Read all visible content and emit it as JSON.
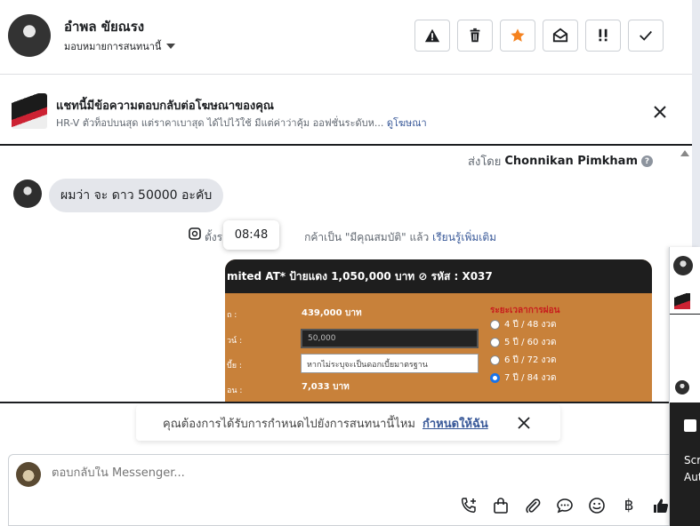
{
  "header": {
    "contact_name": "อำพล ขัยณรง",
    "assign_label": "มอบหมายการสนทนานี้",
    "actions": [
      {
        "name": "mark-spam",
        "icon": "warning-icon"
      },
      {
        "name": "delete",
        "icon": "trash-icon"
      },
      {
        "name": "star",
        "icon": "star-icon",
        "color": "#f5821f"
      },
      {
        "name": "mark-unread",
        "icon": "envelope-open-icon"
      },
      {
        "name": "priority",
        "icon": "exclamation-icon"
      },
      {
        "name": "mark-done",
        "icon": "check-icon"
      }
    ]
  },
  "ad_banner": {
    "title": "แชทนี้มีข้อความตอบกลับต่อโฆษณาของคุณ",
    "description": "HR-V ตัวท็อปบนสุด แต่ราคาเบาสุด ได้ไปไว้ใช้ มีแต่ค่าว่าคุ้ม ออฟชั่นระดับห...",
    "link_label": "ดูโฆษณา"
  },
  "conversation": {
    "sent_by_prefix": "ส่งโดย",
    "sent_by_name": "Chonnikan Pimkham",
    "message_text": "ผมว่า จะ ดาว  50000  อะคับ",
    "system_text_before": "ตั้งร",
    "system_text_after": "กค้าเป็น \"มีคุณสมบัติ\" แล้ว",
    "system_link": "เรียนรู้เพิ่มเติม",
    "timestamp": "08:48"
  },
  "car_image": {
    "header": "mited AT* ป้ายแดง 1,050,000 บาท ⊘ รหัส : X037",
    "labels": [
      "ถ :",
      "วน์ :",
      "บี้ย :",
      "อน :"
    ],
    "price_value": "439,000 บาท",
    "down_input": "50,000",
    "interest_input": "หากไม่ระบุจะเป็นดอกเบี้ยมาตรฐาน",
    "installment_value": "7,033 บาท",
    "period_title": "ระยะเวลาการผ่อน",
    "periods": [
      {
        "label": "4 ปี / 48 งวด",
        "selected": false
      },
      {
        "label": "5 ปี / 60 งวด",
        "selected": false
      },
      {
        "label": "6 ปี / 72 งวด",
        "selected": false
      },
      {
        "label": "7 ปี / 84 งวด",
        "selected": true
      }
    ]
  },
  "followup_prompt": {
    "text": "คุณต้องการได้รับการกำหนดไปยังการสนทนานี้ไหม",
    "link": "กำหนดให้ฉัน"
  },
  "composer": {
    "placeholder": "ตอบกลับใน Messenger...",
    "tools": [
      "phone-plus-icon",
      "shopping-bag-icon",
      "paperclip-icon",
      "chat-bubble-icon",
      "emoji-icon",
      "baht-icon",
      "thumbs-up-icon"
    ],
    "baht_symbol": "฿"
  },
  "side_panel": {
    "text_1": "Scr",
    "text_2": "Aut"
  },
  "colors": {
    "accent_link": "#385898",
    "star": "#f5821f",
    "bubble": "#e4e6eb",
    "image_orange": "#c8813a"
  }
}
